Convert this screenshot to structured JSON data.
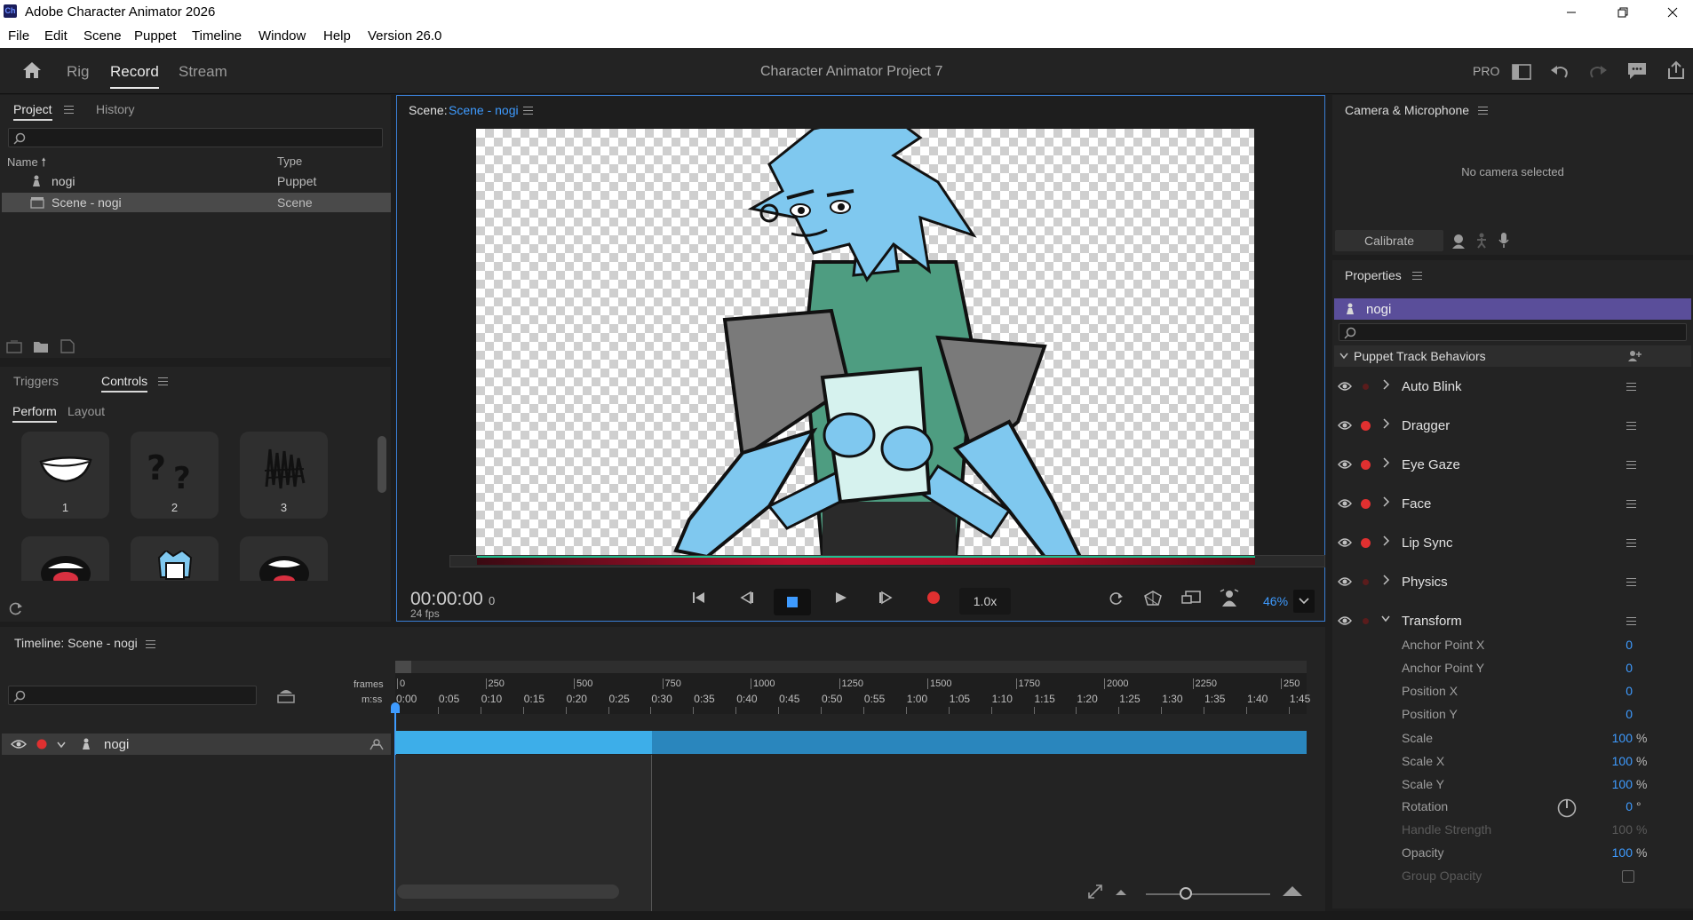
{
  "window": {
    "title": "Adobe Character Animator 2026",
    "app_icon_text": "Ch"
  },
  "menu": [
    "File",
    "Edit",
    "Scene",
    "Puppet",
    "Timeline",
    "Window",
    "Help",
    "Version 26.0"
  ],
  "workspace": {
    "tabs": [
      "Rig",
      "Record",
      "Stream"
    ],
    "active_tab": "Record",
    "project_title": "Character Animator Project 7",
    "pro_label": "PRO"
  },
  "project_panel": {
    "tabs": [
      "Project",
      "History"
    ],
    "columns": {
      "name": "Name",
      "type": "Type"
    },
    "items": [
      {
        "name": "nogi",
        "type": "Puppet",
        "selected": false
      },
      {
        "name": "Scene - nogi",
        "type": "Scene",
        "selected": true
      }
    ]
  },
  "controls_panel": {
    "tabs": [
      "Triggers",
      "Controls"
    ],
    "subtabs": [
      "Perform",
      "Layout"
    ],
    "thumbs": [
      {
        "num": "1",
        "icon": "smile-mouth-icon"
      },
      {
        "num": "2",
        "icon": "question-marks-icon"
      },
      {
        "num": "3",
        "icon": "scribble-icon"
      },
      {
        "num": "",
        "icon": "open-mouth-icon"
      },
      {
        "num": "",
        "icon": "head-portrait-icon"
      },
      {
        "num": "",
        "icon": "open-mouth-2-icon"
      }
    ]
  },
  "scene_panel": {
    "label": "Scene:",
    "scene_name": "Scene - nogi",
    "timecode": "00:00:00",
    "frame": "0",
    "fps": "24 fps",
    "speed": "1.0x",
    "zoom": "46%"
  },
  "camera_panel": {
    "title": "Camera & Microphone",
    "status": "No camera selected",
    "calibrate": "Calibrate"
  },
  "properties_panel": {
    "title": "Properties",
    "puppet_name": "nogi",
    "section": "Puppet Track Behaviors",
    "behaviors": [
      {
        "name": "Auto Blink",
        "armed": false
      },
      {
        "name": "Dragger",
        "armed": true
      },
      {
        "name": "Eye Gaze",
        "armed": true
      },
      {
        "name": "Face",
        "armed": true
      },
      {
        "name": "Lip Sync",
        "armed": true
      },
      {
        "name": "Physics",
        "armed": false
      },
      {
        "name": "Transform",
        "armed": false
      }
    ],
    "transform_params": [
      {
        "name": "Anchor Point X",
        "value": "0",
        "unit": ""
      },
      {
        "name": "Anchor Point Y",
        "value": "0",
        "unit": ""
      },
      {
        "name": "Position X",
        "value": "0",
        "unit": ""
      },
      {
        "name": "Position Y",
        "value": "0",
        "unit": ""
      },
      {
        "name": "Scale",
        "value": "100",
        "unit": "%"
      },
      {
        "name": "Scale X",
        "value": "100",
        "unit": "%"
      },
      {
        "name": "Scale Y",
        "value": "100",
        "unit": "%"
      },
      {
        "name": "Rotation",
        "value": "0",
        "unit": "°"
      },
      {
        "name": "Handle Strength",
        "value": "100",
        "unit": "%",
        "disabled": true
      },
      {
        "name": "Opacity",
        "value": "100",
        "unit": "%"
      },
      {
        "name": "Group Opacity",
        "value": "",
        "unit": "",
        "disabled": true
      }
    ]
  },
  "timeline": {
    "title": "Timeline: Scene - nogi",
    "frames_label": "frames",
    "mss_label": "m:ss",
    "frame_ticks": [
      "0",
      "250",
      "500",
      "750",
      "1000",
      "1250",
      "1500",
      "1750",
      "2000",
      "2250",
      "250"
    ],
    "time_ticks": [
      "0:00",
      "0:05",
      "0:10",
      "0:15",
      "0:20",
      "0:25",
      "0:30",
      "0:35",
      "0:40",
      "0:45",
      "0:50",
      "0:55",
      "1:00",
      "1:05",
      "1:10",
      "1:15",
      "1:20",
      "1:25",
      "1:30",
      "1:35",
      "1:40",
      "1:45"
    ],
    "track_name": "nogi",
    "colors": {
      "track_active": "#3daee9",
      "track_rest": "#2a86bd",
      "accent": "#3e9bff",
      "record": "#e03030"
    }
  }
}
